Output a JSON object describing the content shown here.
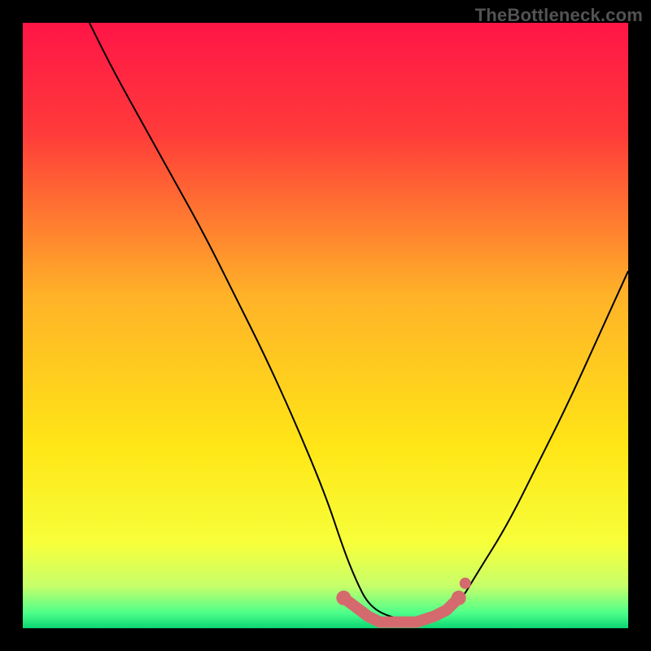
{
  "watermark": "TheBottleneck.com",
  "chart_data": {
    "type": "line",
    "title": "",
    "xlabel": "",
    "ylabel": "",
    "xlim": [
      0,
      100
    ],
    "ylim": [
      0,
      100
    ],
    "grid": false,
    "legend": false,
    "series": [
      {
        "name": "bottleneck-curve",
        "x": [
          11,
          15,
          20,
          25,
          30,
          35,
          40,
          45,
          50,
          53,
          55,
          57,
          60,
          65,
          68,
          72,
          75,
          80,
          85,
          90,
          95,
          100
        ],
        "y": [
          100,
          92,
          83,
          74,
          65,
          55,
          45,
          34,
          22,
          13,
          8,
          4,
          2,
          1,
          2,
          4,
          9,
          17,
          27,
          37,
          48,
          59
        ]
      },
      {
        "name": "flat-marker-band",
        "x": [
          53,
          57,
          59,
          62,
          65,
          68,
          70,
          72
        ],
        "y": [
          5,
          2,
          1,
          1,
          1,
          2,
          3,
          5
        ]
      }
    ],
    "gradient_bands": [
      {
        "stop": 0.0,
        "color": "#ff1547"
      },
      {
        "stop": 0.18,
        "color": "#ff3a3a"
      },
      {
        "stop": 0.45,
        "color": "#ffb228"
      },
      {
        "stop": 0.7,
        "color": "#ffe617"
      },
      {
        "stop": 0.86,
        "color": "#f7ff3a"
      },
      {
        "stop": 0.93,
        "color": "#c7ff6a"
      },
      {
        "stop": 0.975,
        "color": "#4dff8a"
      },
      {
        "stop": 1.0,
        "color": "#0bd673"
      }
    ],
    "marker_color": "#d46a6d"
  }
}
